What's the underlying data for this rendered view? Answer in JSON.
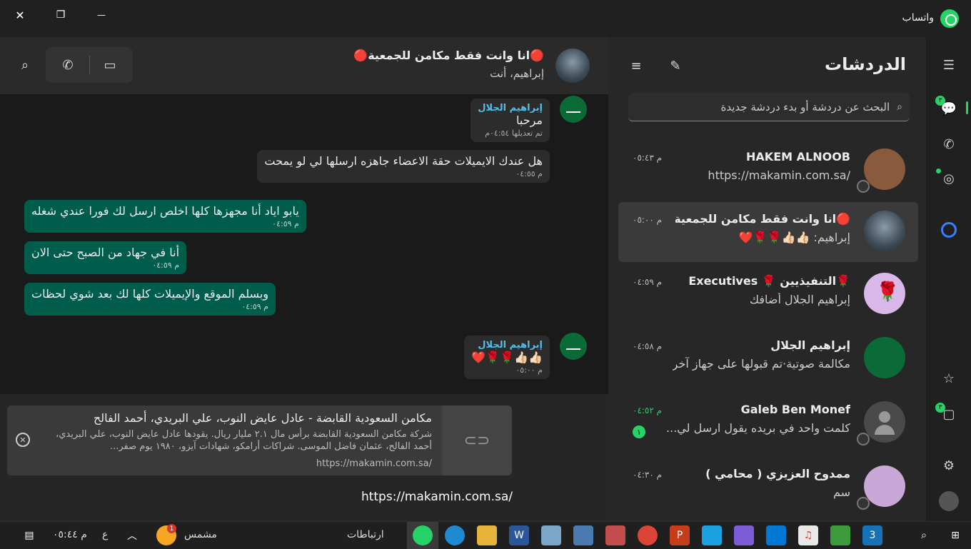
{
  "window": {
    "title": "واتساب",
    "close_glyph": "✕",
    "restore_glyph": "❐",
    "minimize_glyph": "—"
  },
  "rail": {
    "menu_icon": "hamburger-icon",
    "chats_badge": "٣",
    "communities_badge": "٣"
  },
  "chatlist": {
    "title": "الدردشات",
    "search_placeholder": "البحث عن دردشة أو بدء دردشة جديدة",
    "chats": [
      {
        "name": "HAKEM  ALNOOB",
        "preview": "https://makamin.com.sa/",
        "time": "م ٠٥:٤٣",
        "avatar_color": "#8a5a3c"
      },
      {
        "name": "🔴انا وانت فقط مكامن للجمعية...",
        "preview": "إبراهيم: 👍🏻👍🏻🌹🌹❤️",
        "time": "م ٠٥:٠٠",
        "avatar_color": "#55636e"
      },
      {
        "name": "🌹التنفيذيين 🌹 Executives",
        "preview": "إبراهيم الجلال أضافك",
        "time": "م ٠٤:٥٩",
        "avatar_color": "#d9b7e8"
      },
      {
        "name": "إبراهيم الجلال",
        "preview": "مكالمة صوتية·تم قبولها على جهاز آخر",
        "time": "م ٠٤:٥٨",
        "avatar_color": "#0a6b36"
      },
      {
        "name": "Galeb Ben Monef",
        "preview": "كلمت واحد في بريده يقول ارسل لي...",
        "time": "م ٠٤:٥٢",
        "unread": "١",
        "avatar_color": "#4a4a4a"
      },
      {
        "name": "ممدوح العزيزي ( محامي )",
        "preview": "سم",
        "time": "م ٠٤:٣٠",
        "avatar_color": "#c9a8d8"
      }
    ]
  },
  "conversation": {
    "title": "🔴انا وانت فقط مكامن للجمعية🔴",
    "subtitle": "إبراهيم، أنت",
    "messages": [
      {
        "sender": "إبراهيم الجلال",
        "text": "مرحبا",
        "meta": "تم تعديلها  ٠٤:٥٤م"
      },
      {
        "text": "هل عندك الايميلات حقة الاعضاء جاهزه ارسلها لي لو يمحت",
        "meta": "م ٠٤:٥٥"
      },
      {
        "text": "يابو اياد أنا مجهزها كلها اخلص ارسل لك فورا عندي شغله",
        "meta": "م ٠٤:٥٩"
      },
      {
        "text": "أنا في جهاد من الصبح حتى الان",
        "meta": "م ٠٤:٥٩"
      },
      {
        "text": "وبسلم الموقع والإيميلات كلها لك بعد شوي لحظات",
        "meta": "م ٠٤:٥٩"
      },
      {
        "sender": "إبراهيم الجلال",
        "text": "👍🏻👍🏻🌹🌹❤️",
        "meta": "م ٠٥:٠٠"
      }
    ],
    "link_preview": {
      "title": "مكامن السعودية القابضة - عادل عايض النوب، علي البريدي، أحمد الفالح",
      "description": "شركة مكامن السعودية القابضة برأس مال ٢.١ مليار ريال. يقودها عادل عايض النوب، علي البريدي، أحمد الفالح، عثمان فاضل الموسى. شراكات أرامكو، شهادات آيزو، ١٩٨٠ يوم صفر...",
      "url": "https://makamin.com.sa/"
    },
    "input_value": "https://makamin.com.sa/"
  },
  "taskbar": {
    "time": "م ٠٥:٤٤",
    "lang": "ع",
    "weather": "مشمس",
    "weather_badge": "1",
    "links": "ارتباطات"
  }
}
